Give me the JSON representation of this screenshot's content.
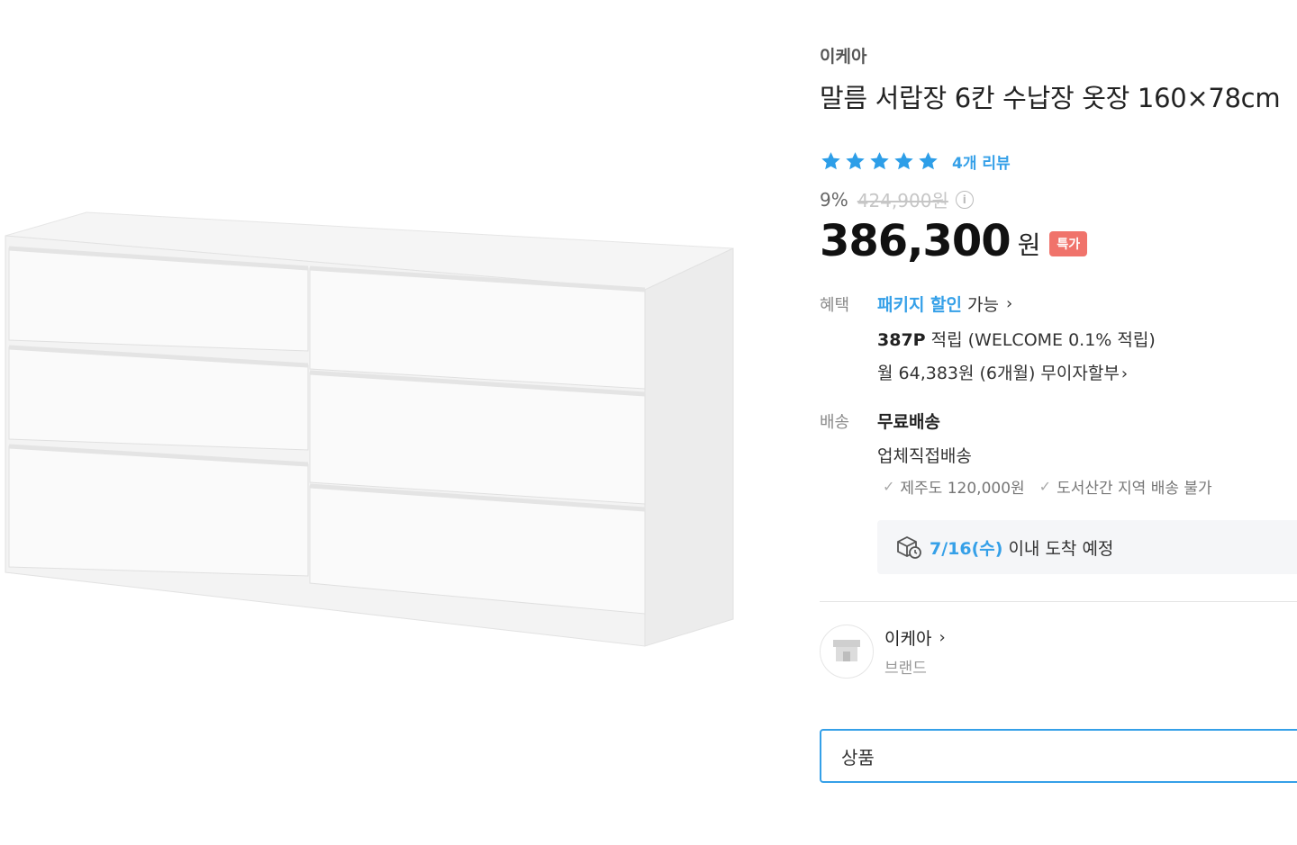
{
  "product": {
    "brand": "이케아",
    "title": "말름 서랍장 6칸 수납장 옷장 160×78cm",
    "rating_stars": 5,
    "review_link": "4개 리뷰",
    "discount_rate": "9%",
    "original_price": "424,900원",
    "price": "386,300",
    "currency": "원",
    "deal_badge": "특가"
  },
  "benefit": {
    "label": "혜택",
    "package_link": "패키지 할인",
    "package_suffix": "가능",
    "points_bold": "387P",
    "points_text": "적립 (WELCOME 0.1% 적립)",
    "installment": "월 64,383원 (6개월) 무이자할부"
  },
  "shipping": {
    "label": "배송",
    "main": "무료배송",
    "type": "업체직접배송",
    "note_jeju": "제주도 120,000원",
    "note_island": "도서산간 지역 배송 불가",
    "arrival_date": "7/16(수)",
    "arrival_text": "이내 도착 예정"
  },
  "brand_card": {
    "name": "이케아",
    "sub": "브랜드"
  },
  "search": {
    "value": "상품"
  },
  "colors": {
    "accent": "#35a0e8",
    "badge": "#f0736b",
    "star": "#2d9ee8"
  },
  "icons": {
    "star": "star-icon",
    "info": "info-icon",
    "chevron": "chevron-right-icon",
    "check": "check-icon",
    "delivery": "delivery-box-icon",
    "store": "store-icon"
  }
}
